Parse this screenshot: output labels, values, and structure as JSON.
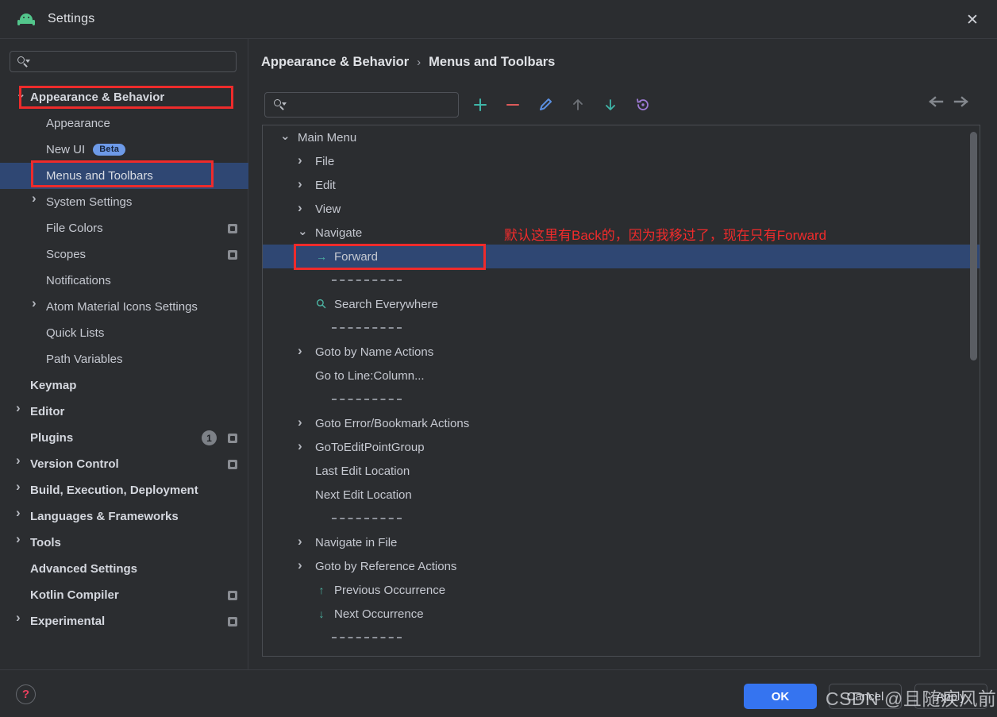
{
  "window": {
    "title": "Settings",
    "app_icon": "android-robot-icon",
    "close_icon": "close-icon"
  },
  "sidebar": {
    "search": {
      "placeholder": "",
      "value": "",
      "icon": "search-icon"
    },
    "items": [
      {
        "label": "Appearance & Behavior",
        "depth": 0,
        "arrow": "chevron-down",
        "bold": true,
        "selected": false,
        "annotated": true
      },
      {
        "label": "Appearance",
        "depth": 1,
        "arrow": "",
        "bold": false,
        "selected": false
      },
      {
        "label": "New UI",
        "depth": 1,
        "arrow": "",
        "bold": false,
        "selected": false,
        "badge": "Beta"
      },
      {
        "label": "Menus and Toolbars",
        "depth": 1,
        "arrow": "",
        "bold": false,
        "selected": true,
        "annotated": true
      },
      {
        "label": "System Settings",
        "depth": 1,
        "arrow": "chevron-right",
        "bold": false,
        "selected": false
      },
      {
        "label": "File Colors",
        "depth": 1,
        "arrow": "",
        "bold": false,
        "selected": false,
        "save_badge": true
      },
      {
        "label": "Scopes",
        "depth": 1,
        "arrow": "",
        "bold": false,
        "selected": false,
        "save_badge": true
      },
      {
        "label": "Notifications",
        "depth": 1,
        "arrow": "",
        "bold": false,
        "selected": false
      },
      {
        "label": "Atom Material Icons Settings",
        "depth": 1,
        "arrow": "chevron-right",
        "bold": false,
        "selected": false
      },
      {
        "label": "Quick Lists",
        "depth": 1,
        "arrow": "",
        "bold": false,
        "selected": false
      },
      {
        "label": "Path Variables",
        "depth": 1,
        "arrow": "",
        "bold": false,
        "selected": false
      },
      {
        "label": "Keymap",
        "depth": 0,
        "arrow": "",
        "bold": true,
        "selected": false
      },
      {
        "label": "Editor",
        "depth": 0,
        "arrow": "chevron-right",
        "bold": true,
        "selected": false
      },
      {
        "label": "Plugins",
        "depth": 0,
        "arrow": "",
        "bold": true,
        "selected": false,
        "count_badge": "1",
        "save_badge": true
      },
      {
        "label": "Version Control",
        "depth": 0,
        "arrow": "chevron-right",
        "bold": true,
        "selected": false,
        "save_badge": true
      },
      {
        "label": "Build, Execution, Deployment",
        "depth": 0,
        "arrow": "chevron-right",
        "bold": true,
        "selected": false
      },
      {
        "label": "Languages & Frameworks",
        "depth": 0,
        "arrow": "chevron-right",
        "bold": true,
        "selected": false
      },
      {
        "label": "Tools",
        "depth": 0,
        "arrow": "chevron-right",
        "bold": true,
        "selected": false
      },
      {
        "label": "Advanced Settings",
        "depth": 0,
        "arrow": "",
        "bold": true,
        "selected": false
      },
      {
        "label": "Kotlin Compiler",
        "depth": 0,
        "arrow": "",
        "bold": true,
        "selected": false,
        "save_badge": true
      },
      {
        "label": "Experimental",
        "depth": 0,
        "arrow": "chevron-right",
        "bold": true,
        "selected": false,
        "save_badge": true
      }
    ]
  },
  "main": {
    "breadcrumb": {
      "parent": "Appearance & Behavior",
      "separator": "›",
      "current": "Menus and Toolbars"
    },
    "history": {
      "back_icon": "arrow-left-icon",
      "forward_icon": "arrow-right-icon"
    },
    "search": {
      "placeholder": "",
      "value": "",
      "icon": "search-icon"
    },
    "toolbar": [
      {
        "name": "add-button",
        "glyph": "+",
        "color": "#3fb5a8"
      },
      {
        "name": "remove-button",
        "glyph": "−",
        "color": "#dd5a5a"
      },
      {
        "name": "edit-button",
        "glyph": "pencil-icon",
        "color": "#5a8fe0"
      },
      {
        "name": "move-up-button",
        "glyph": "↑",
        "color": "#6e7278"
      },
      {
        "name": "move-down-button",
        "glyph": "↓",
        "color": "#3fb5a8"
      },
      {
        "name": "restore-defaults-button",
        "glyph": "revert-icon",
        "color": "#9d7ad4"
      }
    ],
    "tree": [
      {
        "type": "node",
        "label": "Main Menu",
        "depth": 0,
        "arrow": "chevron-down"
      },
      {
        "type": "node",
        "label": "File",
        "depth": 1,
        "arrow": "chevron-right"
      },
      {
        "type": "node",
        "label": "Edit",
        "depth": 1,
        "arrow": "chevron-right"
      },
      {
        "type": "node",
        "label": "View",
        "depth": 1,
        "arrow": "chevron-right"
      },
      {
        "type": "node",
        "label": "Navigate",
        "depth": 1,
        "arrow": "chevron-down"
      },
      {
        "type": "node",
        "label": "Forward",
        "depth": 2,
        "arrow": "",
        "icon": "arrow-right-icon",
        "icon_color": "#4db6a4",
        "selected": true,
        "annotated": true
      },
      {
        "type": "separator"
      },
      {
        "type": "node",
        "label": "Search Everywhere",
        "depth": 2,
        "arrow": "",
        "icon": "search-icon",
        "icon_color": "#4db6a4"
      },
      {
        "type": "separator"
      },
      {
        "type": "node",
        "label": "Goto by Name Actions",
        "depth": 1,
        "arrow": "chevron-right"
      },
      {
        "type": "node",
        "label": "Go to Line:Column...",
        "depth": 1,
        "arrow": ""
      },
      {
        "type": "separator"
      },
      {
        "type": "node",
        "label": "Goto Error/Bookmark Actions",
        "depth": 1,
        "arrow": "chevron-right"
      },
      {
        "type": "node",
        "label": "GoToEditPointGroup",
        "depth": 1,
        "arrow": "chevron-right"
      },
      {
        "type": "node",
        "label": "Last Edit Location",
        "depth": 1,
        "arrow": ""
      },
      {
        "type": "node",
        "label": "Next Edit Location",
        "depth": 1,
        "arrow": ""
      },
      {
        "type": "separator"
      },
      {
        "type": "node",
        "label": "Navigate in File",
        "depth": 1,
        "arrow": "chevron-right"
      },
      {
        "type": "node",
        "label": "Goto by Reference Actions",
        "depth": 1,
        "arrow": "chevron-right"
      },
      {
        "type": "node",
        "label": "Previous Occurrence",
        "depth": 2,
        "arrow": "",
        "icon": "arrow-up-icon",
        "icon_color": "#4db6a4"
      },
      {
        "type": "node",
        "label": "Next Occurrence",
        "depth": 2,
        "arrow": "",
        "icon": "arrow-down-icon",
        "icon_color": "#4db6a4"
      },
      {
        "type": "separator"
      }
    ]
  },
  "annotation": {
    "text": "默认这里有Back的，因为我移过了，现在只有Forward",
    "color": "#f02b2b"
  },
  "footer": {
    "help_icon": "question-mark-icon",
    "ok_label": "OK",
    "cancel_label": "Cancel",
    "apply_label": "Apply",
    "ok_color": "#3574f0"
  },
  "watermark": {
    "text": "CSDN @且随疾风前行."
  }
}
